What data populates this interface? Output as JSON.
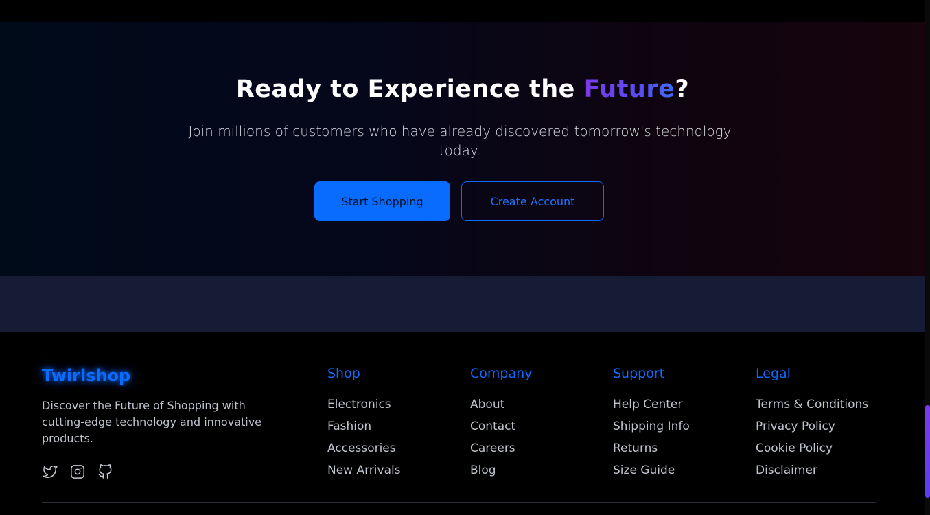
{
  "cta": {
    "title_main": "Ready to Experience the ",
    "title_accent": "Future",
    "title_end": "?",
    "subtitle": "Join millions of customers who have already discovered tomorrow's technology today.",
    "primary_button": "Start Shopping",
    "secondary_button": "Create Account"
  },
  "footer": {
    "brand": "Twirlshop",
    "description": "Discover the Future of Shopping with cutting-edge technology and innovative products.",
    "social": [
      "twitter-icon",
      "instagram-icon",
      "github-icon"
    ],
    "columns": [
      {
        "title": "Shop",
        "links": [
          "Electronics",
          "Fashion",
          "Accessories",
          "New Arrivals"
        ]
      },
      {
        "title": "Company",
        "links": [
          "About",
          "Contact",
          "Careers",
          "Blog"
        ]
      },
      {
        "title": "Support",
        "links": [
          "Help Center",
          "Shipping Info",
          "Returns",
          "Size Guide"
        ]
      },
      {
        "title": "Legal",
        "links": [
          "Terms & Conditions",
          "Privacy Policy",
          "Cookie Policy",
          "Disclaimer"
        ]
      }
    ]
  },
  "colors": {
    "accent_blue": "#0a6bff",
    "accent_purple": "#7c3aed",
    "band": "#161c34"
  }
}
